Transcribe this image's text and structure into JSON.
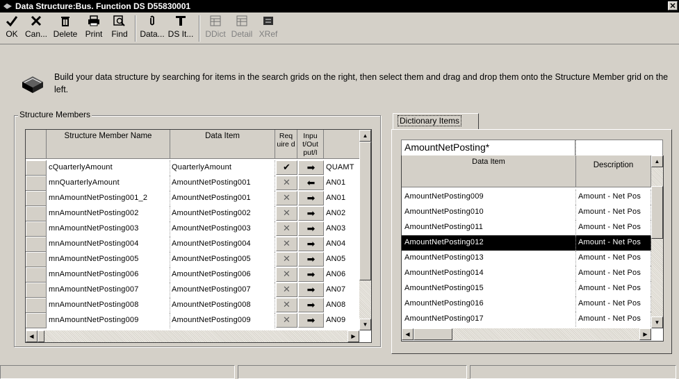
{
  "window": {
    "title": "Data Structure:Bus. Function DS D55830001",
    "close_glyph": "✕"
  },
  "toolbar": {
    "ok": "OK",
    "cancel": "Can...",
    "delete": "Delete",
    "print": "Print",
    "find": "Find",
    "data": "Data...",
    "ds_items": "DS It...",
    "ddict": "DDict",
    "detail": "Detail",
    "xref": "XRef"
  },
  "info": {
    "text": "Build your data structure by searching for items in the search grids on the right, then select them and drag and drop them onto the Structure Member grid on the left."
  },
  "structure_members": {
    "group_label": "Structure Members",
    "columns": [
      "Structure Member Name",
      "Data Item",
      "Req uire d",
      "Inpu t/Out put/I"
    ],
    "rows": [
      {
        "name": "cQuarterlyAmount",
        "item": "QuarterlyAmount",
        "required": "check",
        "io": "right",
        "alias": "QUAMT"
      },
      {
        "name": "mnQuarterlyAmount",
        "item": "AmountNetPosting001",
        "required": "x",
        "io": "left",
        "alias": "AN01"
      },
      {
        "name": "mnAmountNetPosting001_2",
        "item": "AmountNetPosting001",
        "required": "x",
        "io": "right",
        "alias": "AN01"
      },
      {
        "name": "mnAmountNetPosting002",
        "item": "AmountNetPosting002",
        "required": "x",
        "io": "right",
        "alias": "AN02"
      },
      {
        "name": "mnAmountNetPosting003",
        "item": "AmountNetPosting003",
        "required": "x",
        "io": "right",
        "alias": "AN03"
      },
      {
        "name": "mnAmountNetPosting004",
        "item": "AmountNetPosting004",
        "required": "x",
        "io": "right",
        "alias": "AN04"
      },
      {
        "name": "mnAmountNetPosting005",
        "item": "AmountNetPosting005",
        "required": "x",
        "io": "right",
        "alias": "AN05"
      },
      {
        "name": "mnAmountNetPosting006",
        "item": "AmountNetPosting006",
        "required": "x",
        "io": "right",
        "alias": "AN06"
      },
      {
        "name": "mnAmountNetPosting007",
        "item": "AmountNetPosting007",
        "required": "x",
        "io": "right",
        "alias": "AN07"
      },
      {
        "name": "mnAmountNetPosting008",
        "item": "AmountNetPosting008",
        "required": "x",
        "io": "right",
        "alias": "AN08"
      },
      {
        "name": "mnAmountNetPosting009",
        "item": "AmountNetPosting009",
        "required": "x",
        "io": "right",
        "alias": "AN09"
      }
    ]
  },
  "dictionary": {
    "tab_label": "Dictionary Items",
    "search_value": "AmountNetPosting*",
    "columns": [
      "Data Item",
      "Description"
    ],
    "rows": [
      {
        "item": "AmountNetPosting009",
        "desc": "Amount - Net Pos",
        "selected": false
      },
      {
        "item": "AmountNetPosting010",
        "desc": "Amount - Net Pos",
        "selected": false
      },
      {
        "item": "AmountNetPosting011",
        "desc": "Amount - Net Pos",
        "selected": false
      },
      {
        "item": "AmountNetPosting012",
        "desc": "Amount - Net Pos",
        "selected": true
      },
      {
        "item": "AmountNetPosting013",
        "desc": "Amount - Net Pos",
        "selected": false
      },
      {
        "item": "AmountNetPosting014",
        "desc": "Amount - Net Pos",
        "selected": false
      },
      {
        "item": "AmountNetPosting015",
        "desc": "Amount - Net Pos",
        "selected": false
      },
      {
        "item": "AmountNetPosting016",
        "desc": "Amount - Net Pos",
        "selected": false
      },
      {
        "item": "AmountNetPosting017",
        "desc": "Amount - Net Pos",
        "selected": false
      }
    ]
  },
  "glyphs": {
    "check": "✔",
    "x": "✕",
    "right": "➡",
    "left": "⬅",
    "up": "▲",
    "down": "▼",
    "lefta": "◀",
    "righta": "▶"
  }
}
